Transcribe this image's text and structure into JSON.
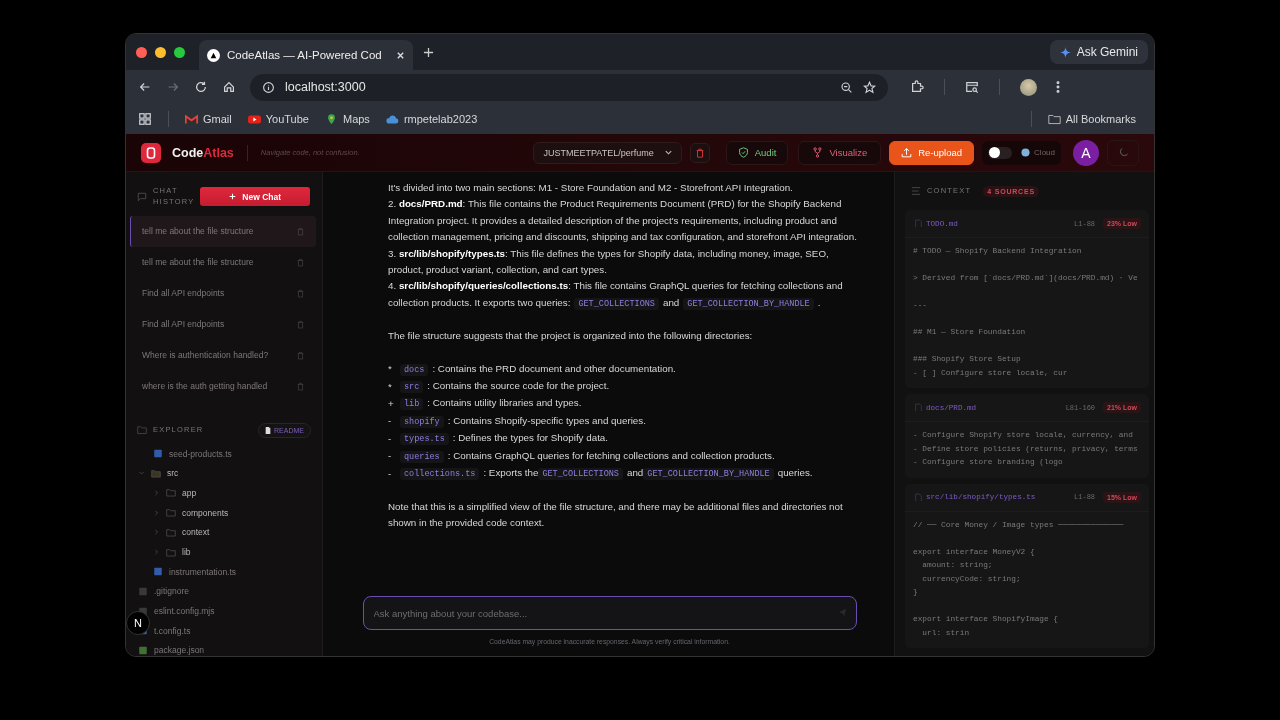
{
  "browser": {
    "tab": {
      "title": "CodeAtlas — AI-Powered Cod",
      "selected": true
    },
    "ask_gemini": "Ask Gemini",
    "url": "localhost:3000",
    "bookmarks": [
      {
        "label": "Gmail",
        "kind": "gmail"
      },
      {
        "label": "YouTube",
        "kind": "youtube"
      },
      {
        "label": "Maps",
        "kind": "maps"
      },
      {
        "label": "rmpetelab2023",
        "kind": "cloud"
      }
    ],
    "all_bookmarks": "All Bookmarks"
  },
  "header": {
    "brand_first": "Code",
    "brand_second": "Atlas",
    "tagline": "Navigate code, not confusion.",
    "repo": "JUSTMEETPATEL/perfume",
    "buttons": [
      {
        "label": "Audit",
        "kind": "audit"
      },
      {
        "label": "Visualize",
        "kind": "visualize"
      },
      {
        "label": "Re-upload",
        "kind": "upload"
      }
    ],
    "mode_toggle": {
      "on": false,
      "label": "Cloud"
    },
    "avatar": "A"
  },
  "sidebar": {
    "chat_history_title": "CHAT HISTORY",
    "new_chat": "New Chat",
    "chats": [
      {
        "title": "tell me about the file structure",
        "selected": true
      },
      {
        "title": "tell me about the file structure",
        "selected": false
      },
      {
        "title": "Find all API endpoints",
        "selected": false
      },
      {
        "title": "Find all API endpoints",
        "selected": false
      },
      {
        "title": "Where is authentication handled?",
        "selected": false
      },
      {
        "title": "where is the auth getting handled",
        "selected": false
      }
    ],
    "explorer_title": "EXPLORER",
    "readme": "README",
    "files": [
      {
        "children": [
          {
            "name": "seed-products.ts",
            "kind": "ts"
          }
        ]
      },
      {
        "name": "src",
        "kind": "folder",
        "expanded": true,
        "children": [
          {
            "name": "app",
            "kind": "folder",
            "expanded": false
          },
          {
            "name": "components",
            "kind": "folder",
            "expanded": false
          },
          {
            "name": "context",
            "kind": "folder",
            "expanded": false
          },
          {
            "name": "lib",
            "kind": "folder",
            "expanded": false
          },
          {
            "name": "instrumentation.ts",
            "kind": "ts"
          }
        ]
      },
      {
        "name": ".gitignore",
        "kind": "plain"
      },
      {
        "name": "eslint.config.mjs",
        "kind": "plain"
      },
      {
        "name": "t.config.ts",
        "kind": "ts"
      },
      {
        "name": "package.json",
        "kind": "json"
      }
    ],
    "dev_badge": "N"
  },
  "answer": {
    "sections": [
      [
        {
          "kind": "para",
          "parts": [
            {
              "kind": "text",
              "text": "It's divided into two main sections: M1 - Store Foundation and M2 - Storefront API Integration."
            }
          ]
        },
        {
          "kind": "para",
          "parts": [
            {
              "kind": "text",
              "text": "2. **docs/PRD.md**: This file contains the Product Requirements Document (PRD) for the Shopify Backend Integration project. It provides a detailed description of the project's requirements, including product and collection management, pricing and discounts, shipping and tax configuration, and storefront API integration."
            }
          ]
        },
        {
          "kind": "para",
          "parts": [
            {
              "kind": "text",
              "text": "3. **src/lib/shopify/types.ts**: This file defines the types for Shopify data, including money, image, SEO, product, product variant, collection, and cart types."
            }
          ]
        },
        {
          "kind": "para",
          "parts": [
            {
              "kind": "text",
              "text": "4. **src/lib/shopify/queries/collections.ts**: This file contains GraphQL queries for fetching collections and collection products. It exports two queries:"
            },
            {
              "kind": "code",
              "text": "GET_COLLECTIONS"
            },
            {
              "kind": "text",
              "text": "and"
            },
            {
              "kind": "code",
              "text": "GET_COLLECTION_BY_HANDLE"
            },
            {
              "kind": "text",
              "text": "."
            }
          ]
        }
      ],
      [
        {
          "kind": "para",
          "parts": [
            {
              "kind": "text",
              "text": "The file structure suggests that the project is organized into the following directories:"
            }
          ]
        }
      ],
      [
        {
          "kind": "bullet",
          "marker": "*",
          "parts": [
            {
              "kind": "code",
              "text": "docs"
            },
            {
              "kind": "text",
              "text": ": Contains the PRD document and other documentation."
            }
          ]
        },
        {
          "kind": "bullet",
          "marker": "*",
          "parts": [
            {
              "kind": "code",
              "text": "src"
            },
            {
              "kind": "text",
              "text": ": Contains the source code for the project."
            }
          ]
        },
        {
          "kind": "bullet",
          "marker": "+",
          "parts": [
            {
              "kind": "code",
              "text": "lib"
            },
            {
              "kind": "text",
              "text": ": Contains utility libraries and types."
            }
          ]
        },
        {
          "kind": "bullet",
          "marker": "-",
          "parts": [
            {
              "kind": "code",
              "text": "shopify"
            },
            {
              "kind": "text",
              "text": ": Contains Shopify-specific types and queries."
            }
          ]
        },
        {
          "kind": "bullet",
          "marker": "-",
          "parts": [
            {
              "kind": "code",
              "text": "types.ts"
            },
            {
              "kind": "text",
              "text": ": Defines the types for Shopify data."
            }
          ]
        },
        {
          "kind": "bullet",
          "marker": "-",
          "parts": [
            {
              "kind": "code",
              "text": "queries"
            },
            {
              "kind": "text",
              "text": ": Contains GraphQL queries for fetching collections and collection products."
            }
          ]
        },
        {
          "kind": "bullet",
          "marker": "-",
          "parts": [
            {
              "kind": "code",
              "text": "collections.ts"
            },
            {
              "kind": "text",
              "text": ": Exports the"
            },
            {
              "kind": "code",
              "text": "GET_COLLECTIONS"
            },
            {
              "kind": "text",
              "text": "and"
            },
            {
              "kind": "code",
              "text": "GET_COLLECTION_BY_HANDLE"
            },
            {
              "kind": "text",
              "text": "queries."
            }
          ]
        }
      ],
      [
        {
          "kind": "para",
          "parts": [
            {
              "kind": "text",
              "text": "Note that this is a simplified view of the file structure, and there may be additional files and directories not shown in the provided code context."
            }
          ]
        }
      ]
    ]
  },
  "composer": {
    "placeholder": "Ask anything about your codebase...",
    "disclaimer": "CodeAtlas may produce inaccurate responses. Always verify critical information."
  },
  "context": {
    "title": "CONTEXT",
    "sources": "4 SOURCES",
    "cards": [
      {
        "file": "TODO.md",
        "lines": "L1-88",
        "score": "23% Low",
        "code": "# TODO — Shopify Backend Integration\n\n> Derived from [`docs/PRD.md`](docs/PRD.md) · Ve\n\n---\n\n## M1 — Store Foundation\n\n### Shopify Store Setup\n- [ ] Configure store locale, cur"
      },
      {
        "file": "docs/PRD.md",
        "lines": "L81-160",
        "score": "21% Low",
        "code": "- Configure Shopify store locale, currency, and\n- Define store policies (returns, privacy, terms\n- Configure store branding (logo"
      },
      {
        "file": "src/lib/shopify/types.ts",
        "lines": "L1-88",
        "score": "15% Low",
        "code": "// ── Core Money / Image types ──────────────\n\nexport interface MoneyV2 {\n  amount: string;\n  currencyCode: string;\n}\n\nexport interface ShopifyImage {\n  url: strin"
      }
    ]
  }
}
